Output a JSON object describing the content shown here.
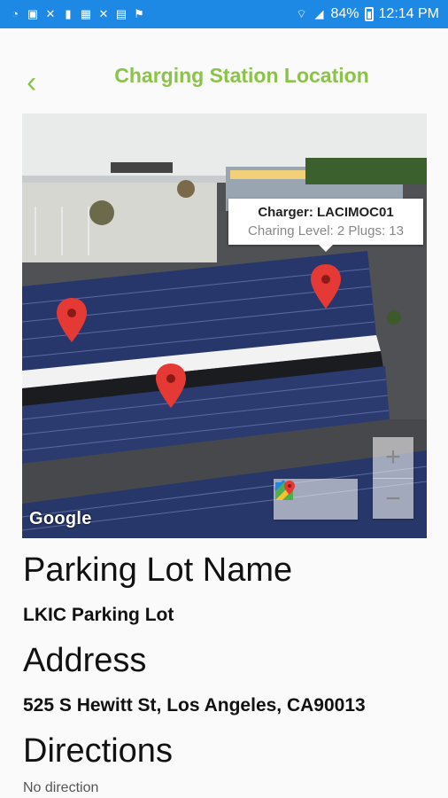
{
  "status_bar": {
    "battery": "84%",
    "time": "12:14 PM",
    "left_icons": [
      "alert-icon",
      "image-icon",
      "tools-icon",
      "lock-icon",
      "calendar-icon",
      "tools-icon",
      "clipboard-icon",
      "flag-icon"
    ],
    "color": "#1e88e5"
  },
  "header": {
    "back_label": "‹",
    "title": "Charging Station Location",
    "accent_color": "#8bc34a"
  },
  "map": {
    "tooltip_title": "Charger: LACIMOC01",
    "tooltip_detail": "Charing Level: 2 Plugs: 13",
    "zoom_in": "+",
    "zoom_out": "−",
    "attribution": "Google",
    "marker_count": 3
  },
  "details": {
    "lot_heading": "Parking Lot Name",
    "lot_value": "LKIC Parking Lot",
    "address_heading": "Address",
    "address_value": "525 S Hewitt St, Los Angeles, CA90013",
    "directions_heading": "Directions",
    "directions_value": "No direction"
  }
}
